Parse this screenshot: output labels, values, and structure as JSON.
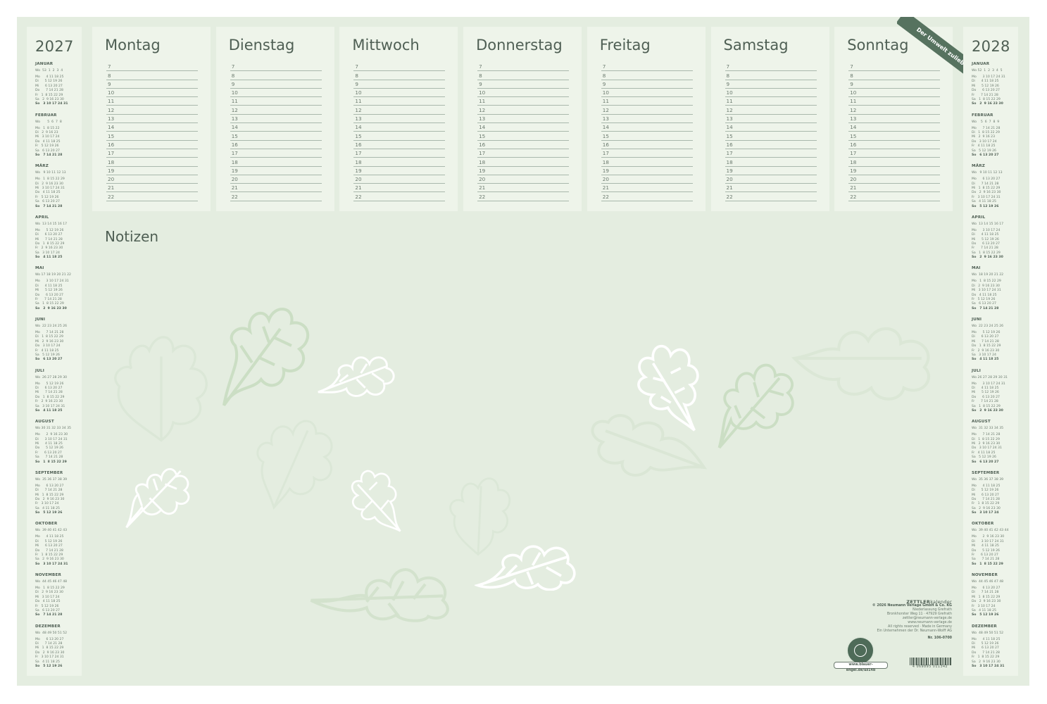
{
  "left_year": {
    "title": "2027",
    "months": [
      {
        "name": "JANUAR",
        "wk": "Wo  53  1  2  3  4",
        "rows": [
          "Mo      4 11 18 25",
          "Di      5 12 19 26",
          "Mi      6 13 20 27",
          "Do      7 14 21 28",
          "Fr   1  8 15 22 29",
          "Sa   2  9 16 23 30",
          "So   3 10 17 24 31"
        ]
      },
      {
        "name": "FEBRUAR",
        "wk": "Wo       5  6  7  8",
        "rows": [
          "Mo   1  8 15 22",
          "Di   2  9 16 23",
          "Mi   3 10 17 24",
          "Do   4 11 18 25",
          "Fr   5 12 19 26",
          "Sa   6 13 20 27",
          "So   7 14 21 28"
        ]
      },
      {
        "name": "MÄRZ",
        "wk": "Wo   9 10 11 12 13",
        "rows": [
          "Mo   1  8 15 22 29",
          "Di   2  9 16 23 30",
          "Mi   3 10 17 24 31",
          "Do   4 11 18 25",
          "Fr   5 12 19 26",
          "Sa   6 13 20 27",
          "So   7 14 21 28"
        ]
      },
      {
        "name": "APRIL",
        "wk": "Wo  13 14 15 16 17",
        "rows": [
          "Mo      5 12 19 26",
          "Di      6 13 20 27",
          "Mi      7 14 21 28",
          "Do   1  8 15 22 29",
          "Fr   2  9 16 23 30",
          "Sa   3 10 17 24",
          "So   4 11 18 25"
        ]
      },
      {
        "name": "MAI",
        "wk": "Wo 17 18 19 20 21 22",
        "rows": [
          "Mo      3 10 17 24 31",
          "Di      4 11 18 25",
          "Mi      5 12 19 26",
          "Do      6 13 20 27",
          "Fr      7 14 21 28",
          "Sa   1  8 15 22 29",
          "So   2  9 16 23 30"
        ]
      },
      {
        "name": "JUNI",
        "wk": "Wo  22 23 24 25 26",
        "rows": [
          "Mo      7 14 21 28",
          "Di   1  8 15 22 29",
          "Mi   2  9 16 23 30",
          "Do   3 10 17 24",
          "Fr   4 11 18 25",
          "Sa   5 12 19 26",
          "So   6 13 20 27"
        ]
      },
      {
        "name": "JULI",
        "wk": "Wo  26 27 28 29 30",
        "rows": [
          "Mo      5 12 19 26",
          "Di      6 13 20 27",
          "Mi      7 14 21 28",
          "Do   1  8 15 22 29",
          "Fr   2  9 16 23 30",
          "Sa   3 10 17 24 31",
          "So   4 11 18 25"
        ]
      },
      {
        "name": "AUGUST",
        "wk": "Wo 30 31 32 33 34 35",
        "rows": [
          "Mo      2  9 16 23 30",
          "Di      3 10 17 24 31",
          "Mi      4 11 18 25",
          "Do      5 12 19 26",
          "Fr      6 13 20 27",
          "Sa      7 14 21 28",
          "So   1  8 15 22 29"
        ]
      },
      {
        "name": "SEPTEMBER",
        "wk": "Wo  35 36 37 38 39",
        "rows": [
          "Mo      6 13 20 27",
          "Di      7 14 21 28",
          "Mi   1  8 15 22 29",
          "Do   2  9 16 23 30",
          "Fr   3 10 17 24",
          "Sa   4 11 18 25",
          "So   5 12 19 26"
        ]
      },
      {
        "name": "OKTOBER",
        "wk": "Wo  39 40 41 42 43",
        "rows": [
          "Mo      4 11 18 25",
          "Di      5 12 19 26",
          "Mi      6 13 20 27",
          "Do      7 14 21 28",
          "Fr   1  8 15 22 29",
          "Sa   2  9 16 23 30",
          "So   3 10 17 24 31"
        ]
      },
      {
        "name": "NOVEMBER",
        "wk": "Wo  44 45 46 47 48",
        "rows": [
          "Mo   1  8 15 22 29",
          "Di   2  9 16 23 30",
          "Mi   3 10 17 24",
          "Do   4 11 18 25",
          "Fr   5 12 19 26",
          "Sa   6 13 20 27",
          "So   7 14 21 28"
        ]
      },
      {
        "name": "DEZEMBER",
        "wk": "Wo  48 49 50 51 52",
        "rows": [
          "Mo      6 13 20 27",
          "Di      7 14 21 28",
          "Mi   1  8 15 22 29",
          "Do   2  9 16 23 30",
          "Fr   3 10 17 24 31",
          "Sa   4 11 18 25",
          "So   5 12 19 26"
        ]
      }
    ]
  },
  "right_year": {
    "title": "2028",
    "months": [
      {
        "name": "JANUAR",
        "wk": "Wo 52  1  2  3  4  5",
        "rows": [
          "Mo      3 10 17 24 31",
          "Di      4 11 18 25",
          "Mi      5 12 19 26",
          "Do      6 13 20 27",
          "Fr      7 14 21 28",
          "Sa   1  8 15 22 29",
          "So   2  9 16 23 30"
        ]
      },
      {
        "name": "FEBRUAR",
        "wk": "Wo    5  6  7  8  9",
        "rows": [
          "Mo      7 14 21 28",
          "Di   1  8 15 22 29",
          "Mi   2  9 16 23",
          "Do   3 10 17 24",
          "Fr   4 11 18 25",
          "Sa   5 12 19 26",
          "So   6 13 20 27"
        ]
      },
      {
        "name": "MÄRZ",
        "wk": "Wo   9 10 11 12 13",
        "rows": [
          "Mo      6 13 20 27",
          "Di      7 14 21 28",
          "Mi   1  8 15 22 29",
          "Do   2  9 16 23 30",
          "Fr   3 10 17 24 31",
          "Sa   4 11 18 25",
          "So   5 12 19 26"
        ]
      },
      {
        "name": "APRIL",
        "wk": "Wo  13 14 15 16 17",
        "rows": [
          "Mo      3 10 17 24",
          "Di      4 11 18 25",
          "Mi      5 12 19 26",
          "Do      6 13 20 27",
          "Fr      7 14 21 28",
          "Sa   1  8 15 22 29",
          "So   2  9 16 23 30"
        ]
      },
      {
        "name": "MAI",
        "wk": "Wo  18 19 20 21 22",
        "rows": [
          "Mo   1  8 15 22 29",
          "Di   2  9 16 23 30",
          "Mi   3 10 17 24 31",
          "Do   4 11 18 25",
          "Fr   5 12 19 26",
          "Sa   6 13 20 27",
          "So   7 14 21 28"
        ]
      },
      {
        "name": "JUNI",
        "wk": "Wo  22 23 24 25 26",
        "rows": [
          "Mo      5 12 19 26",
          "Di      6 13 20 27",
          "Mi      7 14 21 28",
          "Do   1  8 15 22 29",
          "Fr   2  9 16 23 30",
          "Sa   3 10 17 24",
          "So   4 11 18 25"
        ]
      },
      {
        "name": "JULI",
        "wk": "Wo 26 27 28 29 30 31",
        "rows": [
          "Mo      3 10 17 24 31",
          "Di      4 11 18 25",
          "Mi      5 12 19 26",
          "Do      6 13 20 27",
          "Fr      7 14 21 28",
          "Sa   1  8 15 22 29",
          "So   2  9 16 23 30"
        ]
      },
      {
        "name": "AUGUST",
        "wk": "Wo  31 32 33 34 35",
        "rows": [
          "Mo      7 14 21 28",
          "Di   1  8 15 22 29",
          "Mi   2  9 16 23 30",
          "Do   3 10 17 24 31",
          "Fr   4 11 18 25",
          "Sa   5 12 19 26",
          "So   6 13 20 27"
        ]
      },
      {
        "name": "SEPTEMBER",
        "wk": "Wo  35 36 37 38 39",
        "rows": [
          "Mo      4 11 18 25",
          "Di      5 12 19 26",
          "Mi      6 13 20 27",
          "Do      7 14 21 28",
          "Fr   1  8 15 22 29",
          "Sa   2  9 16 23 30",
          "So   3 10 17 24"
        ]
      },
      {
        "name": "OKTOBER",
        "wk": "Wo  39 40 41 42 43 44",
        "rows": [
          "Mo      2  9 16 23 30",
          "Di      3 10 17 24 31",
          "Mi      4 11 18 25",
          "Do      5 12 19 26",
          "Fr      6 13 20 27",
          "Sa      7 14 21 28",
          "So   1  8 15 22 29"
        ]
      },
      {
        "name": "NOVEMBER",
        "wk": "Wo  44 45 46 47 48",
        "rows": [
          "Mo      6 13 20 27",
          "Di      7 14 21 28",
          "Mi   1  8 15 22 29",
          "Do   2  9 16 23 30",
          "Fr   3 10 17 24",
          "Sa   4 11 18 25",
          "So   5 12 19 26"
        ]
      },
      {
        "name": "DEZEMBER",
        "wk": "Wo  48 49 50 51 52",
        "rows": [
          "Mo      4 11 18 25",
          "Di      5 12 19 26",
          "Mi      6 13 20 27",
          "Do      7 14 21 28",
          "Fr   1  8 15 22 29",
          "Sa   2  9 16 23 30",
          "So   3 10 17 24 31"
        ]
      }
    ]
  },
  "week": {
    "days": [
      "Montag",
      "Dienstag",
      "Mittwoch",
      "Donnerstag",
      "Freitag",
      "Samstag",
      "Sonntag"
    ],
    "hours": [
      "7",
      "8",
      "9",
      "10",
      "11",
      "12",
      "13",
      "14",
      "15",
      "16",
      "17",
      "18",
      "19",
      "20",
      "21",
      "22"
    ]
  },
  "notes": {
    "title": "Notizen"
  },
  "ribbon": {
    "text": "Der Umwelt zuliebe!"
  },
  "publisher": {
    "brand_bold": "ZETTLER",
    "brand_thin": "kalender",
    "copyright": "© 2026 Neumann Verlage GmbH & Co. KG",
    "lines": [
      "Niederlassung Grefrath",
      "Bronkhorster Weg 11 · 47929 Grefrath",
      "zettler@neumann-verlage.de",
      "www.neumann-verlage.de",
      "All rights reserved · Made in Germany",
      "Ein Unternehmen der Dr. Neumann-Wolff AG"
    ],
    "order_no": "Nr. 106-0700"
  },
  "eco": {
    "url": "www.blauer-engel.de/uz14b"
  },
  "barcode": {
    "number": "4 069895 011342"
  },
  "colors": {
    "board": "#e4ede0",
    "panel": "#eef4ea",
    "text": "#4f5f54",
    "ribbon": "#56725f",
    "leaf_green": "#cfe0c9",
    "leaf_white": "#ffffff"
  }
}
